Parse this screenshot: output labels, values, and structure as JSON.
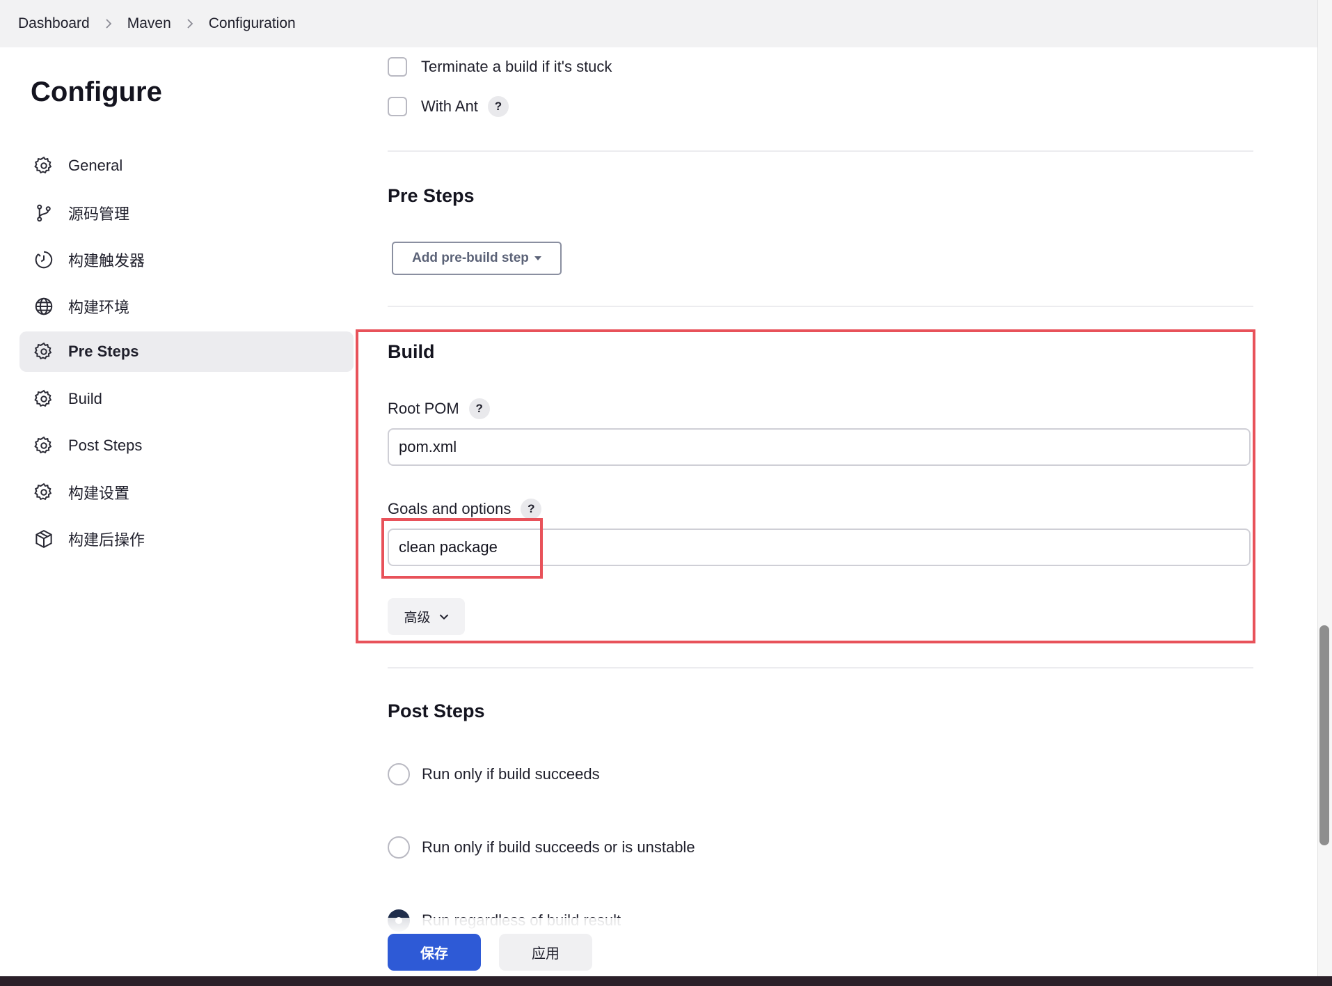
{
  "breadcrumb": {
    "items": [
      "Dashboard",
      "Maven",
      "Configuration"
    ]
  },
  "sidebar": {
    "title": "Configure",
    "items": [
      {
        "label": "General",
        "icon": "gear-icon",
        "active": false
      },
      {
        "label": "源码管理",
        "icon": "git-branch-icon",
        "active": false
      },
      {
        "label": "构建触发器",
        "icon": "timer-icon",
        "active": false
      },
      {
        "label": "构建环境",
        "icon": "globe-icon",
        "active": false
      },
      {
        "label": "Pre Steps",
        "icon": "gear-icon",
        "active": true
      },
      {
        "label": "Build",
        "icon": "gear-icon",
        "active": false
      },
      {
        "label": "Post Steps",
        "icon": "gear-icon",
        "active": false
      },
      {
        "label": "构建设置",
        "icon": "gear-icon",
        "active": false
      },
      {
        "label": "构建后操作",
        "icon": "package-icon",
        "active": false
      }
    ]
  },
  "options": {
    "terminate_label": "Terminate a build if it's stuck",
    "with_ant_label": "With Ant"
  },
  "pre_steps": {
    "title": "Pre Steps",
    "add_button": "Add pre-build step"
  },
  "build": {
    "title": "Build",
    "root_pom_label": "Root POM",
    "root_pom_value": "pom.xml",
    "goals_label": "Goals and options",
    "goals_value": "clean package",
    "advanced_button": "高级"
  },
  "post_steps": {
    "title": "Post Steps",
    "options": [
      {
        "label": "Run only if build succeeds",
        "checked": false
      },
      {
        "label": "Run only if build succeeds or is unstable",
        "checked": false
      },
      {
        "label": "Run regardless of build result",
        "checked": true
      }
    ]
  },
  "help_symbol": "?",
  "footer": {
    "save": "保存",
    "apply": "应用"
  },
  "colors": {
    "primary": "#2e5ad6",
    "highlight": "#e8525a",
    "active_bg": "#ececef"
  }
}
